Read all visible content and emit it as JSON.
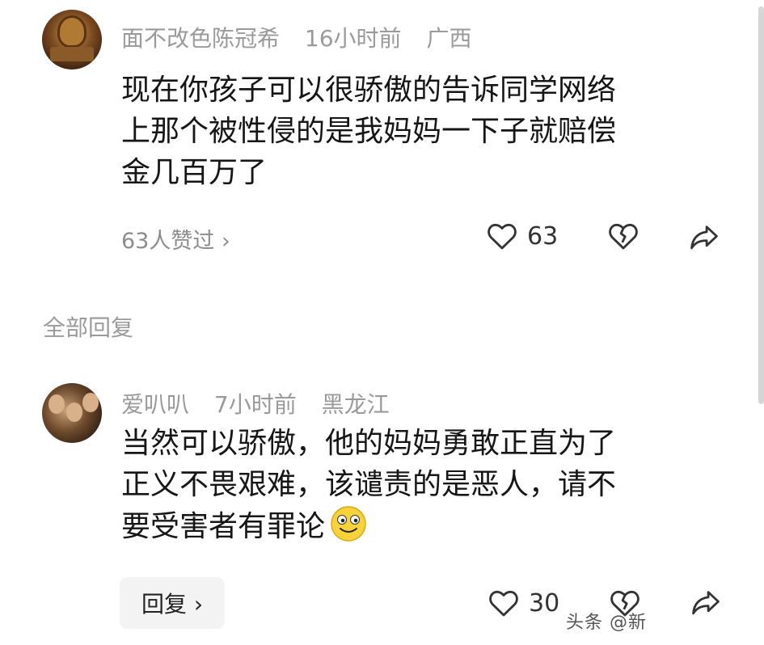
{
  "comment": {
    "username": "面不改色陈冠希",
    "time": "16小时前",
    "location": "广西",
    "text_lines": [
      "现在你孩子可以很骄傲的告诉同学网络",
      "上那个被性侵的是我妈妈一下子就赔偿",
      "金几百万了"
    ],
    "likes_summary": "63人赞过 ›",
    "like_count": "63"
  },
  "section": {
    "label": "全部回复"
  },
  "reply": {
    "username": "爱叭叭",
    "time": "7小时前",
    "location": "黑龙江",
    "text_lines": [
      "当然可以骄傲，他的妈妈勇敢正直为了",
      "正义不畏艰难，该谴责的是恶人，请不",
      "要受害者有罪论"
    ],
    "reply_button_label": "回复 ›",
    "like_count": "30"
  },
  "watermark": "头条 @新"
}
